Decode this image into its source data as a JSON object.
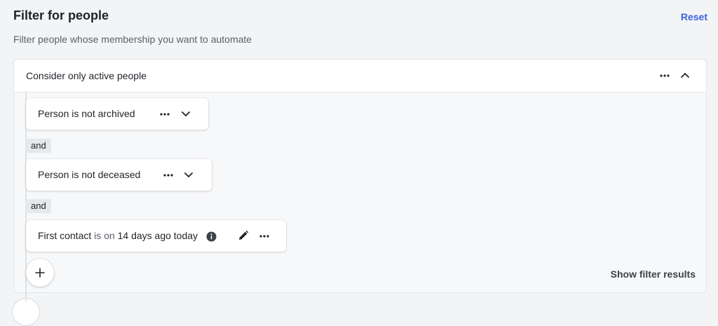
{
  "header": {
    "title": "Filter for people",
    "reset_label": "Reset",
    "subtitle": "Filter people whose membership you want to automate"
  },
  "group": {
    "title": "Consider only active people",
    "icons": {
      "more": "more-horizontal-icon",
      "collapse": "chevron-up-icon"
    }
  },
  "conditions": [
    {
      "label": "Person is not archived"
    },
    {
      "label": "Person is not deceased"
    },
    {
      "field": "First contact",
      "operator": "is on",
      "value": "14 days ago today"
    }
  ],
  "joiners": [
    "and",
    "and"
  ],
  "footer": {
    "show_results_label": "Show filter results"
  },
  "colors": {
    "accent": "#3b62e0",
    "background": "#f3f4f6",
    "card": "#ffffff"
  }
}
